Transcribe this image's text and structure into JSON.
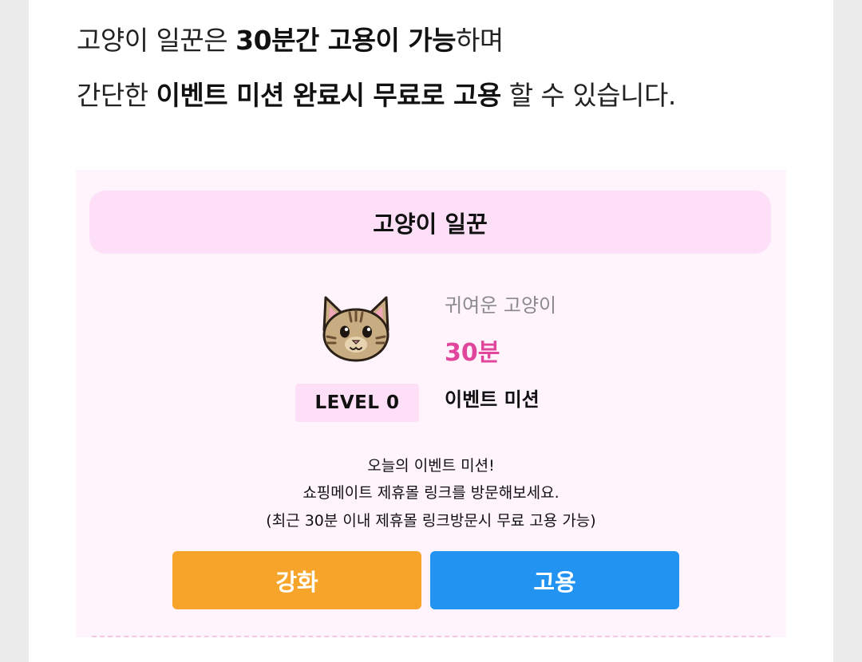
{
  "intro": {
    "line1": {
      "a": "고양이 일꾼은 ",
      "b": "30분간 고용이 가능",
      "c": "하며"
    },
    "line2": {
      "a": "간단한 ",
      "b": "이벤트 미션 완료시 무료로 고용",
      "c": " 할 수 있습니다."
    }
  },
  "card": {
    "title": "고양이 일꾼",
    "level": "LEVEL 0",
    "cat_name": "귀여운 고양이",
    "duration": "30분",
    "mission_label": "이벤트 미션",
    "description": [
      "오늘의 이벤트 미션!",
      "쇼핑메이트 제휴몰 링크를 방문해보세요.",
      "(최근 30분 이내 제휴몰 링크방문시 무료 고용 가능)"
    ],
    "buttons": {
      "enhance": "강화",
      "hire": "고용"
    },
    "icon": "cat-face-icon"
  },
  "colors": {
    "card_bg": "#fff3fc",
    "title_bg": "#fde0f8",
    "accent_pink": "#e0469c",
    "enhance_orange": "#f7a52a",
    "hire_blue": "#2293f0"
  }
}
